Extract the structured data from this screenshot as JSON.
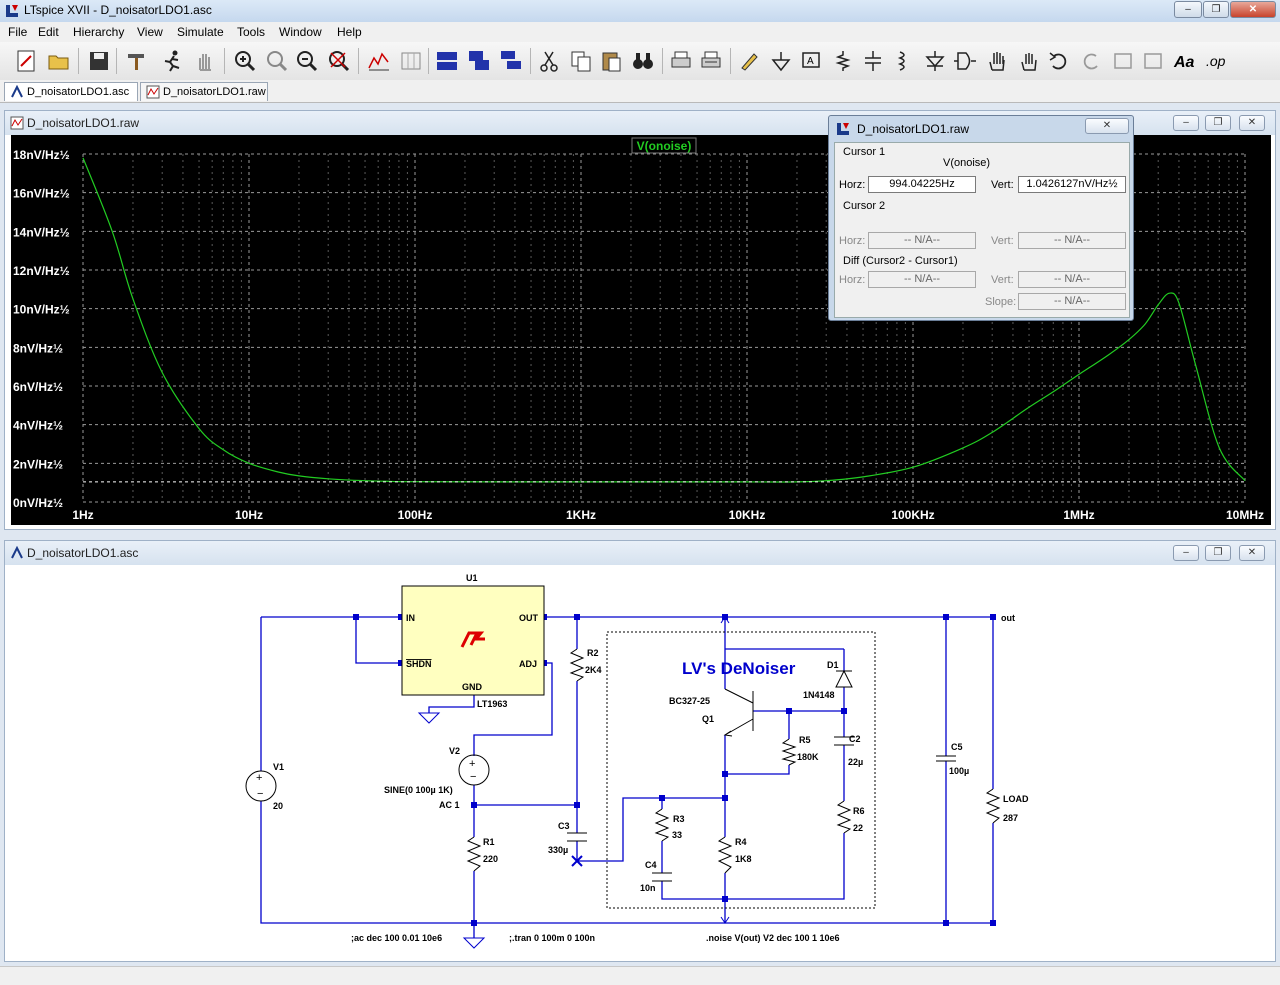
{
  "app": {
    "window_title": "LTspice XVII - D_noisatorLDO1.asc"
  },
  "menu": [
    "File",
    "Edit",
    "Hierarchy",
    "View",
    "Simulate",
    "Tools",
    "Window",
    "Help"
  ],
  "tabs": [
    {
      "label": "D_noisatorLDO1.asc",
      "active": true
    },
    {
      "label": "D_noisatorLDO1.raw",
      "active": false
    }
  ],
  "plot_window": {
    "title": "D_noisatorLDO1.raw",
    "trace_label": "V(onoise)",
    "trace_color": "#22cc22",
    "background": "#000000"
  },
  "chart_data": {
    "type": "line",
    "series": [
      {
        "name": "V(onoise)",
        "x": [
          1,
          1.5,
          2,
          3,
          5,
          7,
          10,
          15,
          20,
          30,
          50,
          70,
          100,
          1000,
          10000,
          20000,
          30000,
          50000,
          100000,
          200000,
          300000,
          500000,
          700000,
          1000000,
          1500000,
          2000000,
          2500000,
          3000000,
          3500000,
          4000000,
          5000000,
          7000000,
          10000000
        ],
        "y": [
          17.8,
          14.0,
          10.5,
          6.7,
          3.8,
          2.7,
          2.0,
          1.55,
          1.35,
          1.2,
          1.1,
          1.07,
          1.05,
          1.04,
          1.04,
          1.04,
          1.1,
          1.3,
          1.8,
          2.8,
          3.6,
          4.9,
          5.7,
          6.6,
          7.6,
          8.4,
          9.2,
          10.2,
          10.8,
          10.3,
          7.2,
          2.8,
          1.1
        ]
      }
    ],
    "x_scale": "log",
    "xlim": [
      1,
      10000000
    ],
    "ylim": [
      0,
      18
    ],
    "x_tick_labels": [
      "1Hz",
      "10Hz",
      "100Hz",
      "1KHz",
      "10KHz",
      "100KHz",
      "1MHz",
      "10MHz"
    ],
    "y_tick_labels": [
      "0nV/Hz½",
      "2nV/Hz½",
      "4nV/Hz½",
      "6nV/Hz½",
      "8nV/Hz½",
      "10nV/Hz½",
      "12nV/Hz½",
      "14nV/Hz½",
      "16nV/Hz½",
      "18nV/Hz½"
    ],
    "y_tick_values": [
      0,
      2,
      4,
      6,
      8,
      10,
      12,
      14,
      16,
      18
    ],
    "grid": true,
    "cursor_y": 1.0426127,
    "cursor_x": 994.04225
  },
  "cursor_dialog": {
    "title": "D_noisatorLDO1.raw",
    "cursor1_label": "Cursor 1",
    "trace": "V(onoise)",
    "horz_label": "Horz:",
    "vert_label": "Vert:",
    "horz_value": "994.04225Hz",
    "vert_value": "1.0426127nV/Hz½",
    "cursor2_label": "Cursor 2",
    "na": "-- N/A--",
    "diff_label": "Diff (Cursor2 - Cursor1)",
    "slope_label": "Slope:"
  },
  "schematic_window": {
    "title": "D_noisatorLDO1.asc",
    "u1_ref": "U1",
    "u1_part": "LT1963",
    "pin_in": "IN",
    "pin_out": "OUT",
    "pin_shdn": "SHDN",
    "pin_adj": "ADJ",
    "pin_gnd": "GND",
    "v1_ref": "V1",
    "v1_val": "20",
    "v2_ref": "V2",
    "v2_val1": "SINE(0 100µ 1K)",
    "v2_val2": "AC 1",
    "r1_ref": "R1",
    "r1_val": "220",
    "r2_ref": "R2",
    "r2_val": "2K4",
    "c3_ref": "C3",
    "c3_val": "330µ",
    "denoiser_label": "LV's DeNoiser",
    "q1_part": "BC327-25",
    "q1_ref": "Q1",
    "d1_ref": "D1",
    "d1_part": "1N4148",
    "r5_ref": "R5",
    "r5_val": "180K",
    "c2_ref": "C2",
    "c2_val": "22µ",
    "r3_ref": "R3",
    "r3_val": "33",
    "r4_ref": "R4",
    "r4_val": "1K8",
    "c4_ref": "C4",
    "c4_val": "10n",
    "r6_ref": "R6",
    "r6_val": "22",
    "c5_ref": "C5",
    "c5_val": "100µ",
    "load_ref": "LOAD",
    "load_val": "287",
    "net_out": "out",
    "dir_ac": ";ac dec 100 0.01 10e6",
    "dir_tran": ";.tran 0 100m 0 100n",
    "dir_noise": ".noise V(out) V2 dec 100 1 10e6",
    "wire_color": "#0000cc",
    "label_color": "#0000cc"
  }
}
